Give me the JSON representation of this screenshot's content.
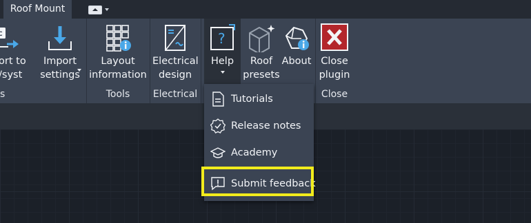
{
  "tabbar": {
    "active_tab": "Roof Mount",
    "quick_access_icon": "window-icon"
  },
  "ribbon": {
    "buttons": {
      "export": {
        "line1": "ort to",
        "line2": "/syst"
      },
      "import": {
        "line1": "Import",
        "line2": "settings"
      },
      "layout": {
        "line1": "Layout",
        "line2": "information"
      },
      "electrical": {
        "line1": "Electrical",
        "line2": "design"
      },
      "help": {
        "line1": "Help"
      },
      "presets": {
        "line1": "Roof",
        "line2": "presets"
      },
      "about": {
        "line1": "About"
      },
      "close": {
        "line1": "Close",
        "line2": "plugin"
      }
    },
    "groups": {
      "first": "s",
      "tools": "Tools",
      "electrical": "Electrical",
      "close": "Close"
    }
  },
  "help_menu": {
    "items": [
      {
        "label": "Tutorials",
        "icon": "document-icon"
      },
      {
        "label": "Release notes",
        "icon": "badge-check-icon"
      },
      {
        "label": "Academy",
        "icon": "graduation-cap-icon"
      },
      {
        "label": "Submit feedback",
        "icon": "feedback-icon"
      }
    ]
  },
  "colors": {
    "ribbon_bg": "#3b4453",
    "accent_blue": "#4aa8e8",
    "close_red": "#b3262b",
    "highlight": "#f2ec1c"
  }
}
